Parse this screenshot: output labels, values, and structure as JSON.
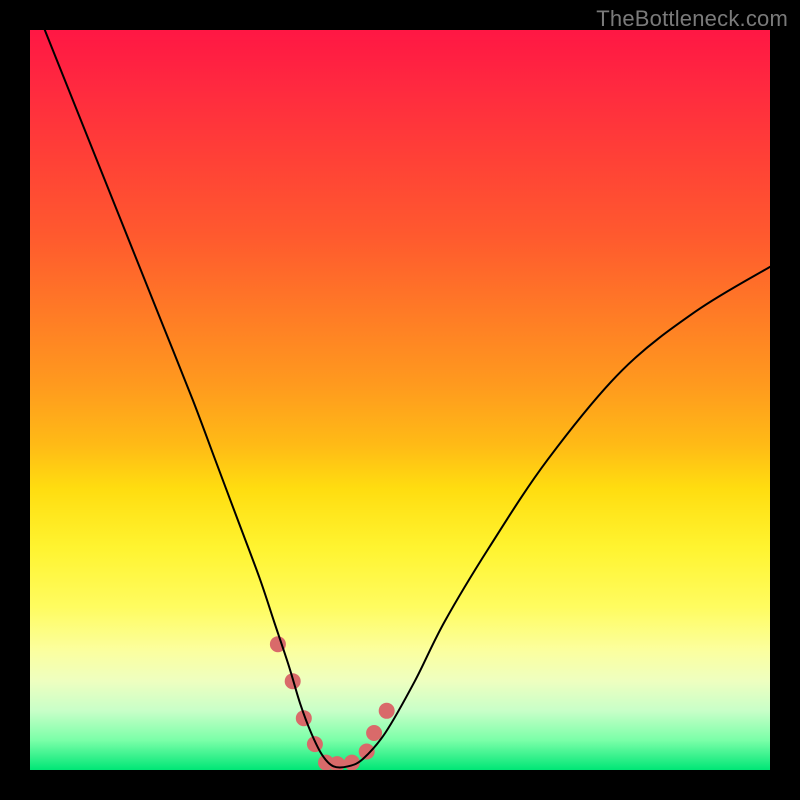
{
  "watermark": "TheBottleneck.com",
  "chart_data": {
    "type": "line",
    "title": "",
    "xlabel": "",
    "ylabel": "",
    "xlim": [
      0,
      100
    ],
    "ylim": [
      0,
      100
    ],
    "grid": false,
    "series": [
      {
        "name": "bottleneck-curve",
        "color": "#000000",
        "width": 2,
        "x": [
          2,
          6,
          10,
          14,
          18,
          22,
          25,
          28,
          31,
          33,
          35,
          36.5,
          38,
          39.5,
          41,
          43,
          45,
          48,
          52,
          56,
          62,
          70,
          80,
          90,
          100
        ],
        "y": [
          100,
          90,
          80,
          70,
          60,
          50,
          42,
          34,
          26,
          20,
          14,
          9,
          5,
          2,
          0.5,
          0.5,
          1.5,
          5,
          12,
          20,
          30,
          42,
          54,
          62,
          68
        ]
      },
      {
        "name": "highlight-dots",
        "color": "#d96a6a",
        "marker_radius": 8,
        "x": [
          33.5,
          35.5,
          37,
          38.5,
          40,
          41.5,
          43.5,
          45.5,
          46.5,
          48.2
        ],
        "y": [
          17,
          12,
          7,
          3.5,
          1,
          0.8,
          1,
          2.5,
          5,
          8
        ]
      }
    ],
    "annotations": []
  }
}
